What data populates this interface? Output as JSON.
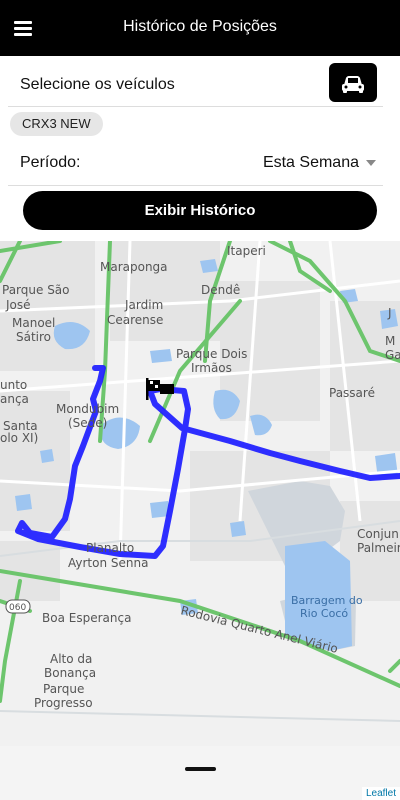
{
  "header": {
    "title": "Histórico de Posições",
    "menu_icon": "hamburger-menu-icon"
  },
  "vehicles": {
    "label": "Selecione os veículos",
    "button_icon": "car-icon",
    "selected_chip": "CRX3 NEW"
  },
  "period": {
    "label": "Período:",
    "selected": "Esta Semana"
  },
  "action": {
    "show_history_label": "Exibir Histórico"
  },
  "map": {
    "labels": {
      "itaperi": "Itaperi",
      "maraponga": "Maraponga",
      "parque_sao_jose_1": "Parque São",
      "parque_sao_jose_2": "José",
      "jardim_cearense_1": "Jardim",
      "jardim_cearense_2": "Cearense",
      "dende": "Dendê",
      "manoel_satiro_1": "Manoel",
      "manoel_satiro_2": "Sátiro",
      "parque_dois_irmaos_1": "Parque Dois",
      "parque_dois_irmaos_2": "Irmãos",
      "jardim_r": "J",
      "m_r": "M",
      "ga_r": "Ga",
      "passare": "Passaré",
      "vicente_pinzon_1": "unto",
      "vicente_pinzon_2": "ança",
      "mondubim_1": "Mondubim",
      "mondubim_2": "(Sede)",
      "santa_1": "Santa",
      "santa_2": "olo XI)",
      "planalto_1": "Planalto",
      "planalto_2": "Ayrton Senna",
      "conjunto_1": "Conjun",
      "conjunto_2": "Palmeir",
      "road_shield": "060",
      "boa_esperanca": "Boa Esperança",
      "barragem_1": "Barragem do",
      "barragem_2": "Rio Cocó",
      "rodovia": "Rodovia Quarto Anel Viário",
      "alto_bonanca_1": "Alto da",
      "alto_bonanca_2": "Bonança",
      "parque_progresso_1": "Parque",
      "parque_progresso_2": "Progresso"
    },
    "route_color": "#1a1aff",
    "start_marker_icon": "flag-icon",
    "attribution": "Leaflet"
  },
  "bottom": {
    "handle": "drawer-handle"
  }
}
